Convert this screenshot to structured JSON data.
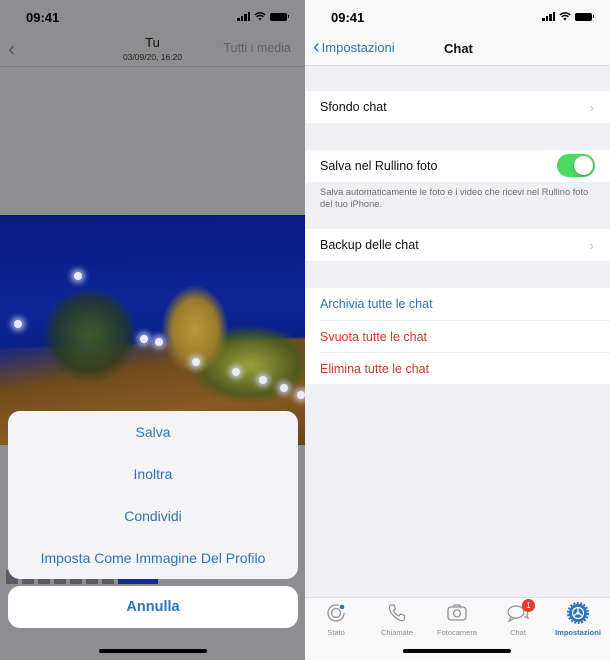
{
  "left_screen": {
    "status_bar": {
      "time": "09:41"
    },
    "nav": {
      "title": "Tu",
      "subtitle": "03/09/20, 16:20",
      "right_button": "Tutti i media",
      "back_icon": "chevron-left-icon"
    },
    "action_sheet": {
      "items": [
        {
          "label": "Salva"
        },
        {
          "label": "Inoltra"
        },
        {
          "label": "Condividi"
        },
        {
          "label": "Imposta Come Immagine Del Profilo"
        }
      ],
      "cancel_label": "Annulla"
    },
    "accent_color": "#2f72b8"
  },
  "right_screen": {
    "status_bar": {
      "time": "09:41"
    },
    "nav": {
      "back_label": "Impostazioni",
      "title": "Chat"
    },
    "rows": {
      "wallpaper": "Sfondo chat",
      "save_to_camera_roll": "Salva nel Rullino foto",
      "save_to_camera_roll_on": true,
      "save_footnote": "Salva automaticamente le foto e i video che ricevi nel Rullino foto del tuo iPhone.",
      "backup": "Backup delle chat",
      "archive_all": "Archivia tutte le chat",
      "clear_all": "Svuota tutte le chat",
      "delete_all": "Elimina tutte le chat"
    },
    "tab_bar": {
      "tabs": [
        {
          "label": "Stato",
          "icon": "status-icon"
        },
        {
          "label": "Chiamate",
          "icon": "phone-icon"
        },
        {
          "label": "Fotocamera",
          "icon": "camera-icon"
        },
        {
          "label": "Chat",
          "icon": "chat-bubbles-icon",
          "badge": "1"
        },
        {
          "label": "Impostazioni",
          "icon": "gear-icon",
          "active": true
        }
      ]
    },
    "colors": {
      "accent": "#2f72b8",
      "destructive": "#d0382e",
      "toggle_on": "#4cd964",
      "badge": "#e8392f"
    }
  }
}
